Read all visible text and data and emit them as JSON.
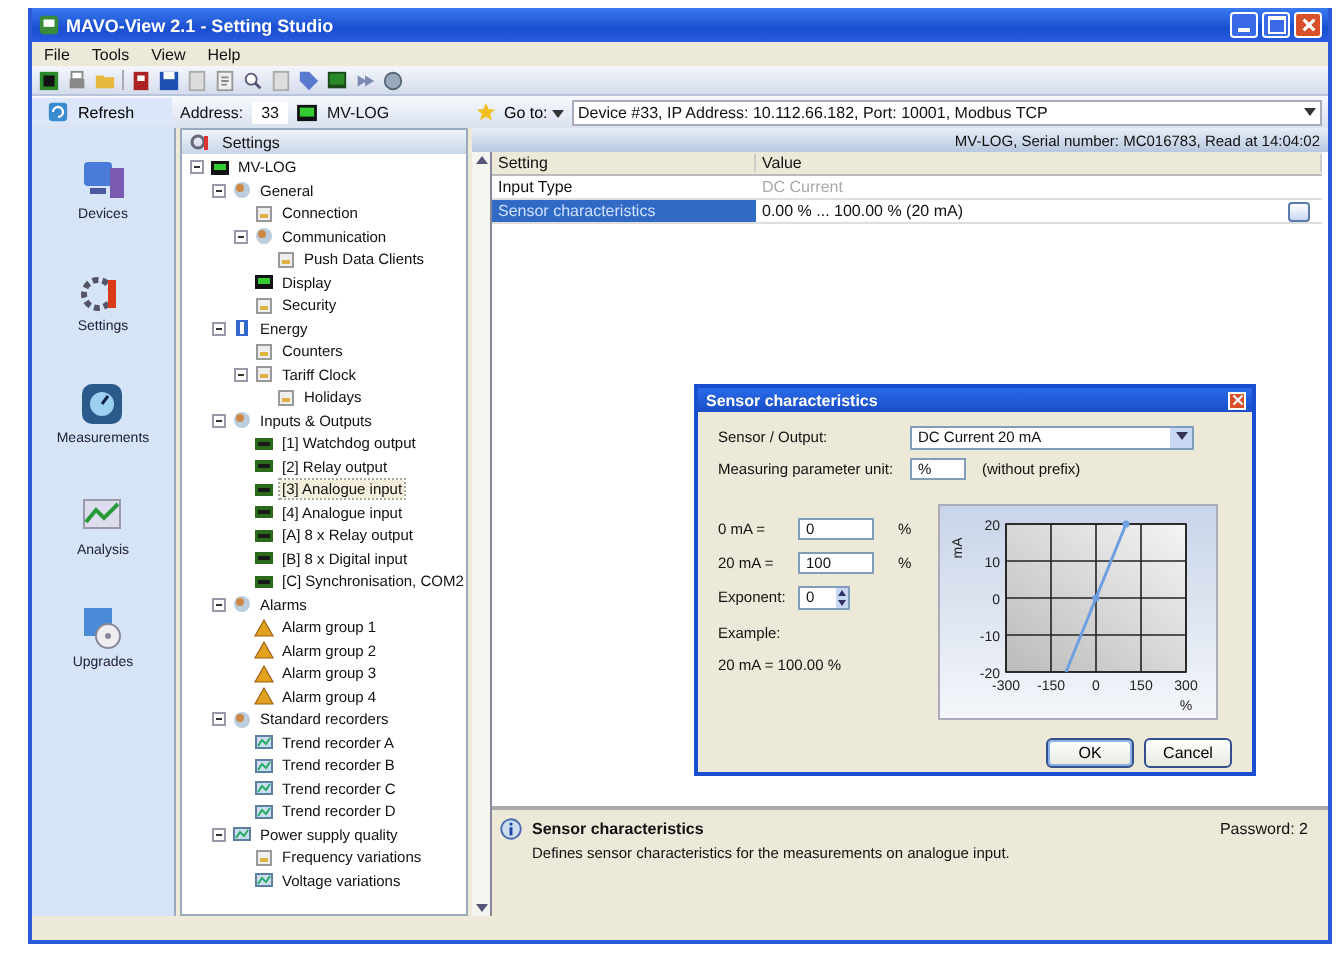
{
  "window": {
    "title": "MAVO-View 2.1 - Setting Studio"
  },
  "menu": [
    "File",
    "Tools",
    "View",
    "Help"
  ],
  "address_bar": {
    "refresh": "Refresh",
    "address_label": "Address:",
    "address": "33",
    "device": "MV-LOG",
    "goto_label": "Go to:",
    "goto_value": "Device #33, IP Address: 10.112.66.182, Port: 10001, Modbus TCP"
  },
  "sidebar": {
    "items": [
      {
        "label": "Devices",
        "kind": "devices"
      },
      {
        "label": "Settings",
        "kind": "settings"
      },
      {
        "label": "Measurements",
        "kind": "measurements"
      },
      {
        "label": "Analysis",
        "kind": "analysis"
      },
      {
        "label": "Upgrades",
        "kind": "upgrades"
      }
    ]
  },
  "tree": {
    "header": "Settings",
    "items": [
      {
        "label": "MV-LOG",
        "kind": "device",
        "selected": false,
        "expanded": true,
        "children": [
          {
            "label": "General",
            "kind": "group",
            "selected": false,
            "expanded": true,
            "children": [
              {
                "label": "Connection",
                "kind": "page",
                "selected": false
              },
              {
                "label": "Communication",
                "kind": "group",
                "selected": false,
                "expanded": true,
                "children": [
                  {
                    "label": "Push Data Clients",
                    "kind": "page",
                    "selected": false
                  }
                ]
              },
              {
                "label": "Display",
                "kind": "device",
                "selected": false
              },
              {
                "label": "Security",
                "kind": "page",
                "selected": false
              }
            ]
          },
          {
            "label": "Energy",
            "kind": "energy",
            "selected": false,
            "expanded": true,
            "children": [
              {
                "label": "Counters",
                "kind": "page",
                "selected": false
              },
              {
                "label": "Tariff Clock",
                "kind": "page",
                "selected": false,
                "expanded": true,
                "children": [
                  {
                    "label": "Holidays",
                    "kind": "page",
                    "selected": false
                  }
                ]
              }
            ]
          },
          {
            "label": "Inputs & Outputs",
            "kind": "group",
            "selected": false,
            "expanded": true,
            "children": [
              {
                "label": "[1] Watchdog output",
                "kind": "port",
                "selected": false
              },
              {
                "label": "[2] Relay output",
                "kind": "port",
                "selected": false
              },
              {
                "label": "[3] Analogue input",
                "kind": "port",
                "selected": true
              },
              {
                "label": "[4] Analogue input",
                "kind": "port",
                "selected": false
              },
              {
                "label": "[A] 8 x Relay output",
                "kind": "port",
                "selected": false
              },
              {
                "label": "[B] 8 x Digital input",
                "kind": "port",
                "selected": false
              },
              {
                "label": "[C] Synchronisation, COM2",
                "kind": "port",
                "selected": false
              }
            ]
          },
          {
            "label": "Alarms",
            "kind": "group",
            "selected": false,
            "expanded": true,
            "children": [
              {
                "label": "Alarm group 1",
                "kind": "alarm",
                "selected": false
              },
              {
                "label": "Alarm group 2",
                "kind": "alarm",
                "selected": false
              },
              {
                "label": "Alarm group 3",
                "kind": "alarm",
                "selected": false
              },
              {
                "label": "Alarm group 4",
                "kind": "alarm",
                "selected": false
              }
            ]
          },
          {
            "label": "Standard recorders",
            "kind": "group",
            "selected": false,
            "expanded": true,
            "children": [
              {
                "label": "Trend recorder A",
                "kind": "recorder",
                "selected": false
              },
              {
                "label": "Trend recorder B",
                "kind": "recorder",
                "selected": false
              },
              {
                "label": "Trend recorder C",
                "kind": "recorder",
                "selected": false
              },
              {
                "label": "Trend recorder D",
                "kind": "recorder",
                "selected": false
              }
            ]
          },
          {
            "label": "Power supply quality",
            "kind": "recorder",
            "selected": false,
            "expanded": true,
            "children": [
              {
                "label": "Frequency variations",
                "kind": "page",
                "selected": false
              },
              {
                "label": "Voltage variations",
                "kind": "recorder",
                "selected": false
              }
            ]
          }
        ]
      }
    ]
  },
  "info_bar": "MV-LOG, Serial number: MC016783, Read at 14:04:02",
  "table": {
    "columns": [
      "Setting",
      "Value"
    ],
    "rows": [
      {
        "setting": "Input Type",
        "value": "DC Current",
        "disabled": true,
        "selected": false,
        "has_button": false
      },
      {
        "setting": "Sensor characteristics",
        "value": "0.00 % ... 100.00 % (20 mA)",
        "disabled": false,
        "selected": true,
        "has_button": true
      }
    ]
  },
  "description": {
    "title": "Sensor characteristics",
    "password": "Password: 2",
    "text": "Defines sensor characteristics for the measurements on analogue input."
  },
  "dialog": {
    "title": "Sensor characteristics",
    "sensor_label": "Sensor / Output:",
    "sensor_value": "DC Current 20 mA",
    "unit_label": "Measuring parameter unit:",
    "unit_value": "%",
    "unit_hint": "(without prefix)",
    "rows": [
      {
        "label": "0 mA =",
        "value": "0",
        "unit": "%"
      },
      {
        "label": "20 mA =",
        "value": "100",
        "unit": "%"
      }
    ],
    "exponent_label": "Exponent:",
    "exponent_value": "0",
    "example_label": "Example:",
    "example_value": "20 mA = 100.00 %",
    "chart_data": {
      "type": "line",
      "ylabel": "mA",
      "xlabel": "%",
      "x": [
        -100,
        0,
        100
      ],
      "values": [
        -20,
        0,
        20
      ],
      "grid": true,
      "xlim": [
        -300,
        300
      ],
      "ylim": [
        -20,
        20
      ],
      "xticks": [
        -300,
        -150,
        0,
        150,
        300
      ],
      "yticks": [
        -20,
        -10,
        0,
        10,
        20
      ]
    },
    "buttons": [
      "OK",
      "Cancel"
    ]
  }
}
